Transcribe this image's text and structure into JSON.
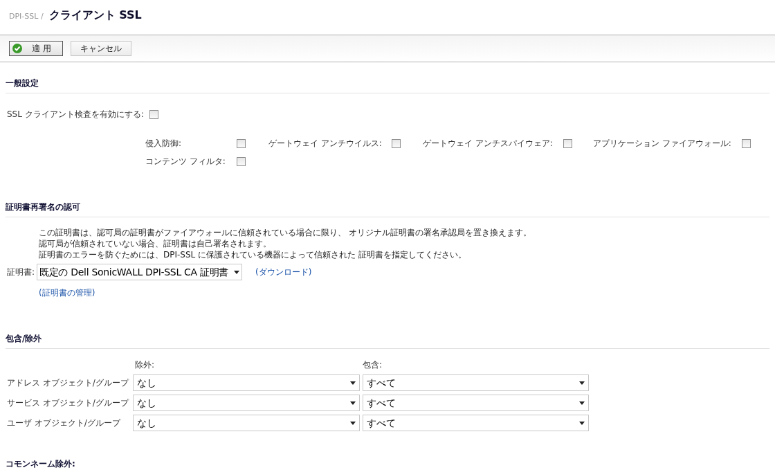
{
  "breadcrumb": "DPI-SSL /",
  "title": "クライアント SSL",
  "toolbar": {
    "apply": "適 用",
    "cancel": "キャンセル"
  },
  "general": {
    "heading": "一般設定",
    "enable": {
      "label": "SSL クライアント検査を有効にする:",
      "checked": false
    },
    "options": [
      {
        "label": "侵入防御:",
        "checked": false
      },
      {
        "label": "ゲートウェイ アンチウイルス:",
        "checked": false
      },
      {
        "label": "ゲートウェイ アンチスパイウェア:",
        "checked": false
      },
      {
        "label": "アプリケーション ファイアウォール:",
        "checked": false
      },
      {
        "label": "コンテンツ フィルタ:",
        "checked": false
      }
    ]
  },
  "certificate": {
    "heading": "証明書再署名の認可",
    "description": [
      "この証明書は、認可局の証明書がファイアウォールに信頼されている場合に限り、 オリジナル証明書の署名承認局を置き換えます。",
      "認可局が信頼されていない場合、証明書は自己署名されます。",
      "証明書のエラーを防ぐためには、DPI-SSL に保護されている機器によって信頼された 証明書を指定してください。"
    ],
    "label": "証明書:",
    "value": "既定の Dell SonicWALL DPI-SSL CA 証明書",
    "download": "(ダウンロード)",
    "manage": "(証明書の管理)"
  },
  "inclusion": {
    "heading": "包含/除外",
    "columns": [
      "除外:",
      "包含:"
    ],
    "rows": [
      {
        "label": "アドレス オブジェクト/グループ",
        "exclude": "なし",
        "include": "すべて"
      },
      {
        "label": "サービス オブジェクト/グループ",
        "exclude": "なし",
        "include": "すべて"
      },
      {
        "label": "ユーザ オブジェクト/グループ",
        "exclude": "なし",
        "include": "すべて"
      }
    ]
  },
  "common_name": {
    "heading": "コモンネーム除外:"
  }
}
